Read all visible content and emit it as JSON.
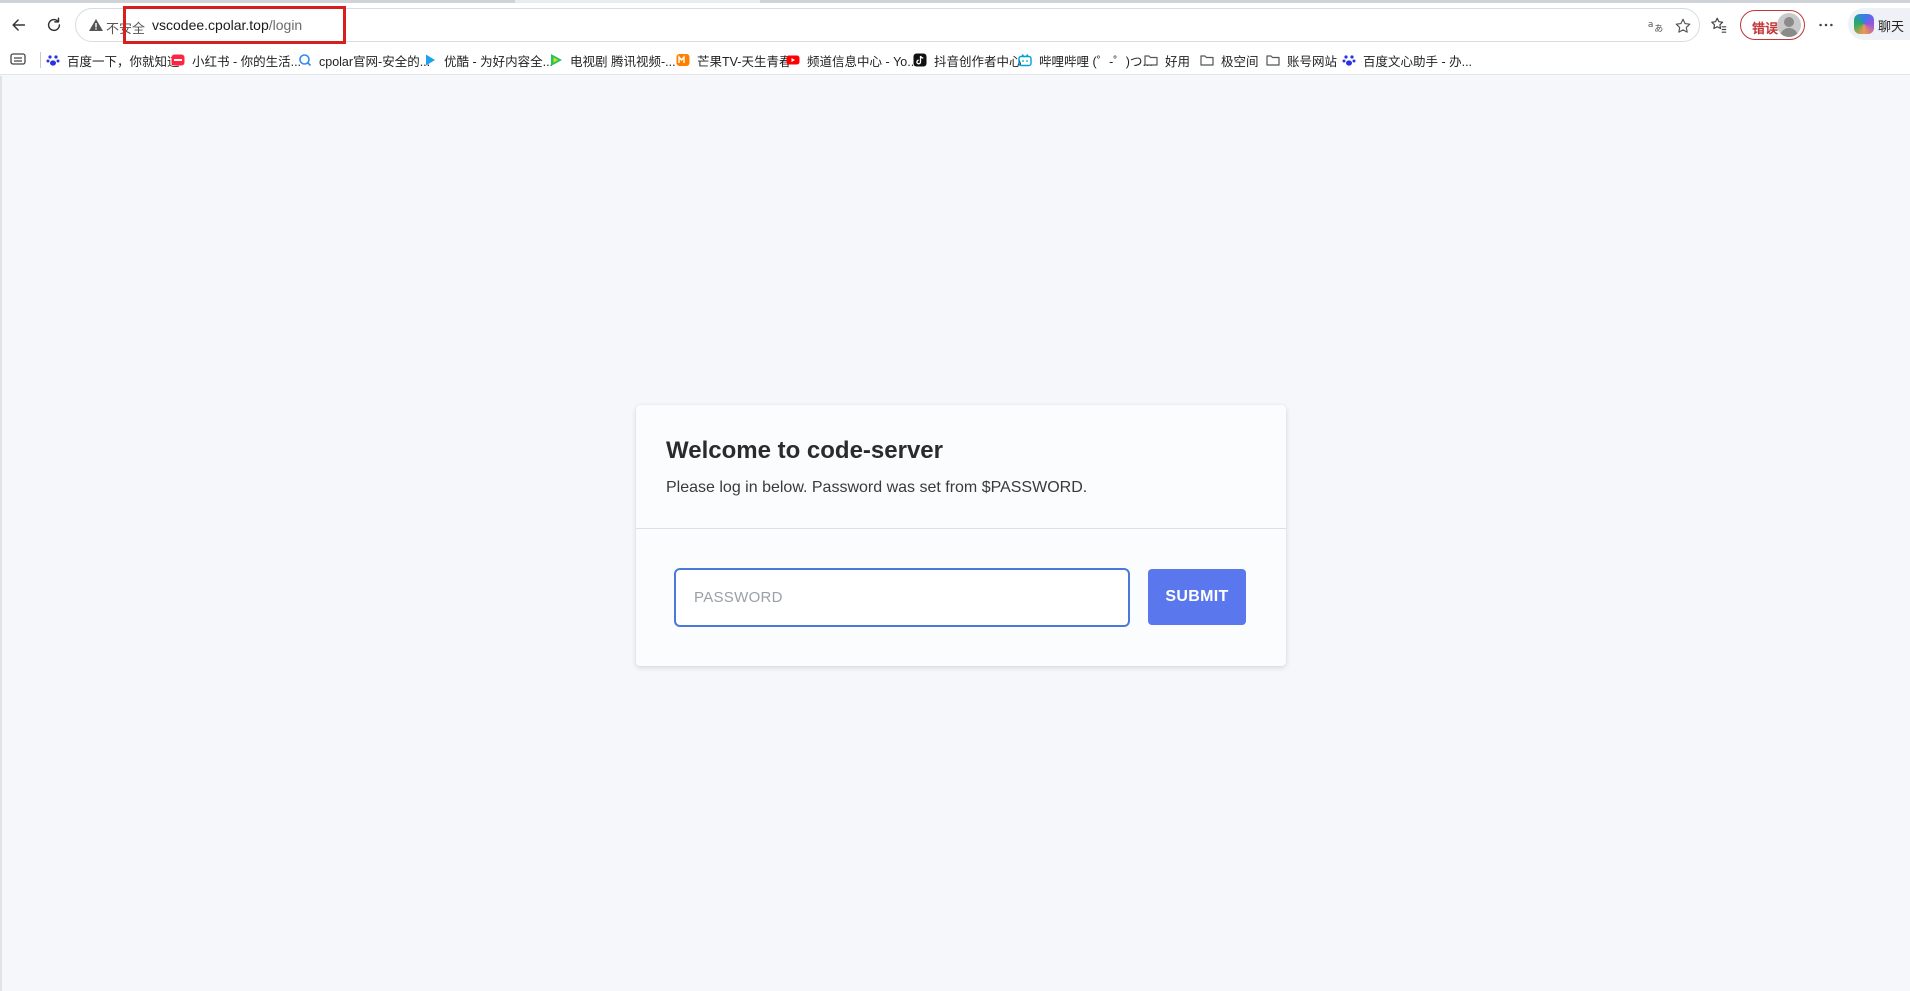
{
  "browser": {
    "address": {
      "insecure_label": "不安全",
      "url_host": "vscodee.cpolar.top",
      "url_path": "/login"
    },
    "profile": {
      "error_label": "错误"
    },
    "copilot_label": "聊天",
    "bookmarks": [
      {
        "label": "百度一下，你就知道",
        "icon": "baidu-paw-icon",
        "color": "#2932e1"
      },
      {
        "label": "小红书 - 你的生活...",
        "icon": "xiaohongshu-icon",
        "color": "#ff2442"
      },
      {
        "label": "cpolar官网-安全的...",
        "icon": "cpolar-icon",
        "color": "#2d8cf0"
      },
      {
        "label": "优酷 - 为好内容全...",
        "icon": "youku-icon",
        "color": "#1ea1f3"
      },
      {
        "label": "电视剧 腾讯视频-...",
        "icon": "tencent-video-icon",
        "color": "#1ec760"
      },
      {
        "label": "芒果TV-天生青春",
        "icon": "mango-tv-icon",
        "color": "#ff7f00"
      },
      {
        "label": "频道信息中心 - Yo...",
        "icon": "youtube-icon",
        "color": "#ff0000"
      },
      {
        "label": "抖音创作者中心",
        "icon": "douyin-icon",
        "color": "#111111"
      },
      {
        "label": "哔哩哔哩 (゜-゜)つ...",
        "icon": "bilibili-icon",
        "color": "#00a1d6"
      },
      {
        "label": "好用",
        "icon": "folder-icon",
        "color": "#555555"
      },
      {
        "label": "极空间",
        "icon": "folder-icon",
        "color": "#555555"
      },
      {
        "label": "账号网站",
        "icon": "folder-icon",
        "color": "#555555"
      },
      {
        "label": "百度文心助手 - 办...",
        "icon": "baidu-paw-icon",
        "color": "#2932e1"
      }
    ]
  },
  "login": {
    "title": "Welcome to code-server",
    "subtitle": "Please log in below. Password was set from $PASSWORD.",
    "password_placeholder": "PASSWORD",
    "password_value": "",
    "submit_label": "SUBMIT"
  },
  "colors": {
    "accent": "#5a77ee",
    "input_focus_border": "#4b79d9",
    "highlight_box": "#d62020",
    "page_background": "#f5f7fa"
  }
}
